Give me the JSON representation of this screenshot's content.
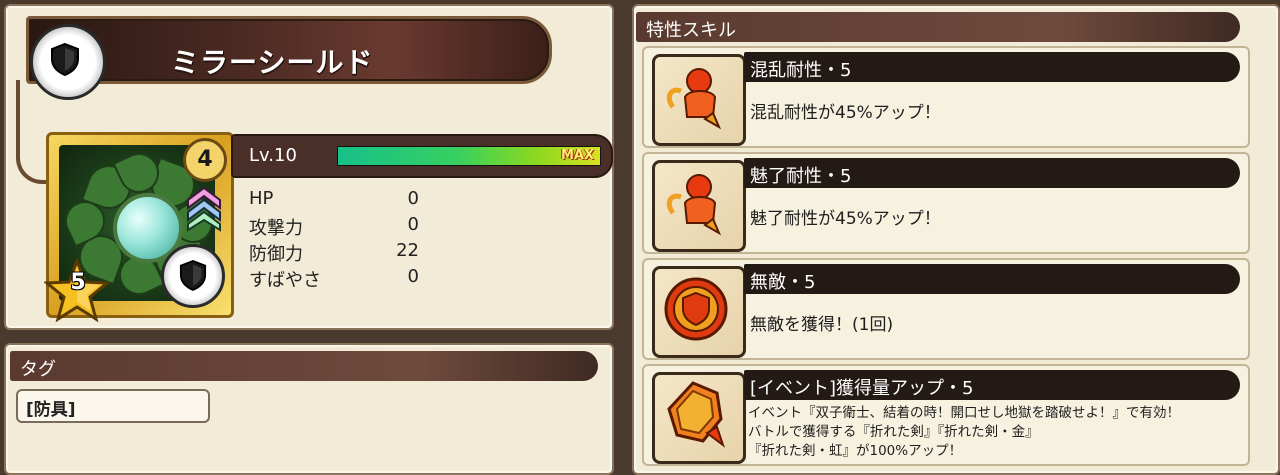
{
  "item": {
    "name": "ミラーシールド",
    "level_label": "Lv.10",
    "max_label": "MAX",
    "exp_progress": 1.0,
    "rank_number": "4",
    "star_number": "5",
    "stats": [
      {
        "label": "HP",
        "value": "0"
      },
      {
        "label": "攻撃力",
        "value": "0"
      },
      {
        "label": "防御力",
        "value": "22"
      },
      {
        "label": "すばやさ",
        "value": "0"
      }
    ]
  },
  "tags": {
    "header": "タグ",
    "items": [
      "[防具]"
    ]
  },
  "skills": {
    "header": "特性スキル",
    "items": [
      {
        "name": "混乱耐性・5",
        "desc": "混乱耐性が45%アップ！",
        "icon": "confusion-resist-icon"
      },
      {
        "name": "魅了耐性・5",
        "desc": "魅了耐性が45%アップ！",
        "icon": "charm-resist-icon"
      },
      {
        "name": "無敵・5",
        "desc": "無敵を獲得！(1回)",
        "icon": "invincible-shield-icon"
      },
      {
        "name": "[イベント]獲得量アップ・5",
        "desc_lines": [
          "イベント『双子衛士、結着の時！開口せし地獄を踏破せよ！』で有効！",
          "バトルで獲得する『折れた剣』『折れた剣・金』",
          "『折れた剣・虹』が100%アップ！"
        ],
        "icon": "gem-up-icon"
      }
    ]
  },
  "colors": {
    "panel_bg": "#f2ebd8",
    "header_bg": "#5a3a30",
    "skill_name_bg": "#231a15",
    "exp_bar": "#36d060",
    "max_text": "#ffec70"
  }
}
